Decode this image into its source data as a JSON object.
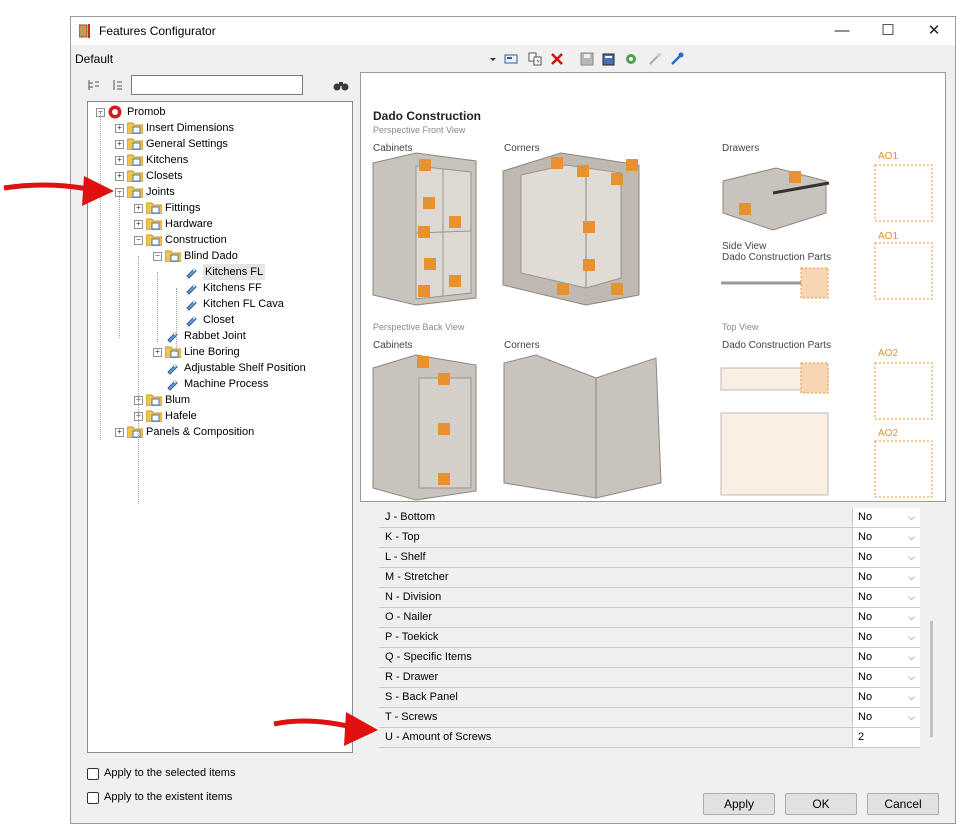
{
  "window": {
    "title": "Features Configurator",
    "minimize": "—",
    "maximize": "☐",
    "close": "✕"
  },
  "profile": "Default",
  "tree": [
    {
      "label": "Promob"
    },
    {
      "label": "Insert Dimensions"
    },
    {
      "label": "General Settings"
    },
    {
      "label": "Kitchens"
    },
    {
      "label": "Closets"
    },
    {
      "label": "Joints"
    },
    {
      "label": "Fittings"
    },
    {
      "label": "Hardware"
    },
    {
      "label": "Construction"
    },
    {
      "label": "Blind Dado"
    },
    {
      "label": "Kitchens FL"
    },
    {
      "label": "Kitchens FF"
    },
    {
      "label": "Kitchen FL Cava"
    },
    {
      "label": "Closet"
    },
    {
      "label": "Rabbet Joint"
    },
    {
      "label": "Line Boring"
    },
    {
      "label": "Adjustable Shelf Position"
    },
    {
      "label": "Machine Process"
    },
    {
      "label": "Blum"
    },
    {
      "label": "Hafele"
    },
    {
      "label": "Panels & Composition"
    }
  ],
  "image": {
    "title": "Dado Construction",
    "front_view": "Perspective Front View",
    "cabinets": "Cabinets",
    "corners": "Corners",
    "drawers": "Drawers",
    "side_view": "Side View",
    "dado_parts": "Dado Construction Parts",
    "back_view": "Perspective Back View",
    "cabinets2": "Cabinets",
    "corners2": "Corners",
    "top_view": "Top View",
    "dado_parts2": "Dado Construction Parts",
    "ao1": "AO1",
    "ao2": "AO2"
  },
  "properties": [
    {
      "name": "J -  Bottom",
      "value": "No"
    },
    {
      "name": "K -  Top",
      "value": "No"
    },
    {
      "name": "L -  Shelf",
      "value": "No"
    },
    {
      "name": "M -  Stretcher",
      "value": "No"
    },
    {
      "name": "N -  Division",
      "value": "No"
    },
    {
      "name": "O -  Nailer",
      "value": "No"
    },
    {
      "name": "P -  Toekick",
      "value": "No"
    },
    {
      "name": "Q -  Specific Items",
      "value": "No"
    },
    {
      "name": "R -  Drawer",
      "value": "No"
    },
    {
      "name": "S - Back Panel",
      "value": "No"
    },
    {
      "name": "T - Screws",
      "value": "No"
    },
    {
      "name": "U - Amount of Screws",
      "value": "2"
    }
  ],
  "options": {
    "apply_selected": "Apply to the selected items",
    "apply_existent": "Apply to the existent items"
  },
  "buttons": {
    "apply": "Apply",
    "ok": "OK",
    "cancel": "Cancel"
  },
  "colors": {
    "accent": "#e8912f",
    "arrow": "#e01010",
    "folder": "#f2c54a"
  }
}
